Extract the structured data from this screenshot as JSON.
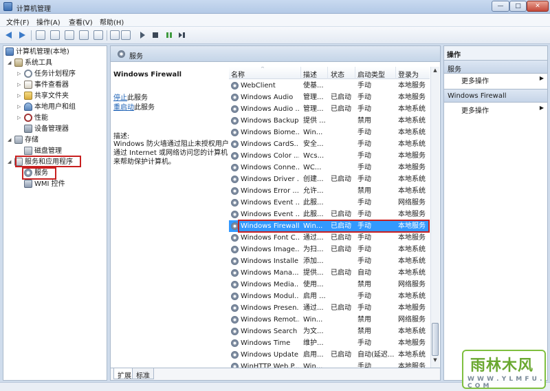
{
  "window": {
    "title": "计算机管理",
    "minimize": "—",
    "maximize": "□",
    "close": "✕"
  },
  "menu": [
    "文件(F)",
    "操作(A)",
    "查看(V)",
    "帮助(H)"
  ],
  "toolbar": {
    "icons": [
      "back-icon",
      "forward-icon",
      "up-icon",
      "show-hide-tree-icon",
      "refresh-icon",
      "export-icon",
      "help-icon",
      "properties-icon",
      "start-icon",
      "stop-icon",
      "pause-icon",
      "restart-icon"
    ]
  },
  "tree": {
    "root": "计算机管理(本地)",
    "system_tools": "系统工具",
    "task_scheduler": "任务计划程序",
    "event_viewer": "事件查看器",
    "shared_folders": "共享文件夹",
    "local_users": "本地用户和组",
    "performance": "性能",
    "device_manager": "设备管理器",
    "storage": "存储",
    "disk_management": "磁盘管理",
    "services_apps": "服务和应用程序",
    "services": "服务",
    "wmi": "WMI 控件"
  },
  "services_panel": {
    "header": "服务",
    "selected_name": "Windows Firewall",
    "stop_link": "停止",
    "stop_rest": "此服务",
    "restart_link": "重启动",
    "restart_rest": "此服务",
    "desc_label": "描述:",
    "description": "Windows 防火墙通过阻止未授权用户通过 Internet 或网络访问您的计算机来帮助保护计算机。"
  },
  "grid": {
    "columns": {
      "name": "名称",
      "desc": "描述",
      "status": "状态",
      "startup": "启动类型",
      "logon": "登录为"
    },
    "sort_arrow": "^",
    "rows": [
      {
        "name": "WebClient",
        "desc": "使基...",
        "status": "",
        "startup": "手动",
        "logon": "本地服务"
      },
      {
        "name": "Windows Audio",
        "desc": "管理...",
        "status": "已启动",
        "startup": "手动",
        "logon": "本地服务"
      },
      {
        "name": "Windows Audio ...",
        "desc": "管理...",
        "status": "已启动",
        "startup": "手动",
        "logon": "本地系统"
      },
      {
        "name": "Windows Backup",
        "desc": "提供 ...",
        "status": "",
        "startup": "禁用",
        "logon": "本地系统"
      },
      {
        "name": "Windows Biome...",
        "desc": "Win...",
        "status": "",
        "startup": "手动",
        "logon": "本地系统"
      },
      {
        "name": "Windows CardS...",
        "desc": "安全...",
        "status": "",
        "startup": "手动",
        "logon": "本地系统"
      },
      {
        "name": "Windows Color ...",
        "desc": "Wcs...",
        "status": "",
        "startup": "手动",
        "logon": "本地服务"
      },
      {
        "name": "Windows Conne...",
        "desc": "WC...",
        "status": "",
        "startup": "手动",
        "logon": "本地服务"
      },
      {
        "name": "Windows Driver ...",
        "desc": "创建...",
        "status": "已启动",
        "startup": "手动",
        "logon": "本地系统"
      },
      {
        "name": "Windows Error ...",
        "desc": "允许...",
        "status": "",
        "startup": "禁用",
        "logon": "本地系统"
      },
      {
        "name": "Windows Event ...",
        "desc": "此服...",
        "status": "",
        "startup": "手动",
        "logon": "网络服务"
      },
      {
        "name": "Windows Event ...",
        "desc": "此服...",
        "status": "已启动",
        "startup": "手动",
        "logon": "本地服务"
      },
      {
        "name": "Windows Firewall",
        "desc": "Win...",
        "status": "已启动",
        "startup": "手动",
        "logon": "本地服务"
      },
      {
        "name": "Windows Font C...",
        "desc": "通过...",
        "status": "已启动",
        "startup": "手动",
        "logon": "本地服务"
      },
      {
        "name": "Windows Image...",
        "desc": "为扫...",
        "status": "已启动",
        "startup": "手动",
        "logon": "本地系统"
      },
      {
        "name": "Windows Installer",
        "desc": "添加...",
        "status": "",
        "startup": "手动",
        "logon": "本地系统"
      },
      {
        "name": "Windows Mana...",
        "desc": "提供...",
        "status": "已启动",
        "startup": "自动",
        "logon": "本地系统"
      },
      {
        "name": "Windows Media...",
        "desc": "使用...",
        "status": "",
        "startup": "禁用",
        "logon": "网络服务"
      },
      {
        "name": "Windows Modul...",
        "desc": "启用 ...",
        "status": "",
        "startup": "手动",
        "logon": "本地系统"
      },
      {
        "name": "Windows Presen...",
        "desc": "通过...",
        "status": "已启动",
        "startup": "手动",
        "logon": "本地服务"
      },
      {
        "name": "Windows Remot...",
        "desc": "Win...",
        "status": "",
        "startup": "禁用",
        "logon": "网络服务"
      },
      {
        "name": "Windows Search",
        "desc": "为文...",
        "status": "",
        "startup": "禁用",
        "logon": "本地系统"
      },
      {
        "name": "Windows Time",
        "desc": "维护...",
        "status": "",
        "startup": "手动",
        "logon": "本地服务"
      },
      {
        "name": "Windows Update",
        "desc": "启用...",
        "status": "已启动",
        "startup": "自动(延迟...",
        "logon": "本地系统"
      },
      {
        "name": "WinHTTP Web P...",
        "desc": "Win...",
        "status": "",
        "startup": "手动",
        "logon": "本地服务"
      }
    ],
    "selected_index": 12
  },
  "tabs": [
    "扩展",
    "标准"
  ],
  "actions": {
    "title": "操作",
    "group1": "服务",
    "group1_item": "更多操作",
    "group2": "Windows Firewall",
    "group2_item": "更多操作",
    "arrow": "▶"
  },
  "watermark": {
    "big": "雨林木风",
    "small": "W W W . Y L M F U . C O M"
  }
}
